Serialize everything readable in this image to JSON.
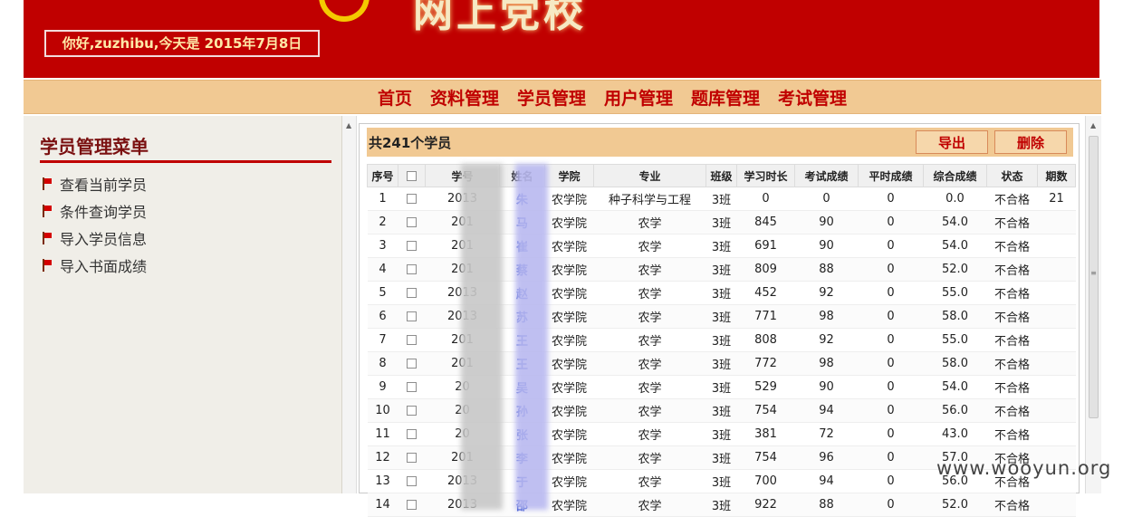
{
  "banner": {
    "logo_text": "网上党校",
    "greeting": "你好,zuzhibu,今天是 2015年7月8日"
  },
  "nav": {
    "items": [
      "首页",
      "资料管理",
      "学员管理",
      "用户管理",
      "题库管理",
      "考试管理"
    ]
  },
  "sidebar": {
    "title": "学员管理菜单",
    "items": [
      "查看当前学员",
      "条件查询学员",
      "导入学员信息",
      "导入书面成绩"
    ]
  },
  "list": {
    "count_label": "共241个学员",
    "export_label": "导出",
    "delete_label": "删除",
    "columns": [
      "序号",
      "",
      "学号",
      "姓名",
      "学院",
      "专业",
      "班级",
      "学习时长",
      "考试成绩",
      "平时成绩",
      "综合成绩",
      "状态",
      "期数"
    ],
    "rows": [
      [
        "1",
        "",
        "2013",
        "朱",
        "农学院",
        "种子科学与工程",
        "3班",
        "0",
        "0",
        "0",
        "0.0",
        "不合格",
        "21"
      ],
      [
        "2",
        "",
        "201",
        "马",
        "农学院",
        "农学",
        "3班",
        "845",
        "90",
        "0",
        "54.0",
        "不合格",
        ""
      ],
      [
        "3",
        "",
        "201",
        "崔",
        "农学院",
        "农学",
        "3班",
        "691",
        "90",
        "0",
        "54.0",
        "不合格",
        ""
      ],
      [
        "4",
        "",
        "201",
        "蔡",
        "农学院",
        "农学",
        "3班",
        "809",
        "88",
        "0",
        "52.0",
        "不合格",
        ""
      ],
      [
        "5",
        "",
        "2013",
        "赵",
        "农学院",
        "农学",
        "3班",
        "452",
        "92",
        "0",
        "55.0",
        "不合格",
        ""
      ],
      [
        "6",
        "",
        "2013",
        "苏",
        "农学院",
        "农学",
        "3班",
        "771",
        "98",
        "0",
        "58.0",
        "不合格",
        ""
      ],
      [
        "7",
        "",
        "201",
        "王",
        "农学院",
        "农学",
        "3班",
        "808",
        "92",
        "0",
        "55.0",
        "不合格",
        ""
      ],
      [
        "8",
        "",
        "201",
        "王",
        "农学院",
        "农学",
        "3班",
        "772",
        "98",
        "0",
        "58.0",
        "不合格",
        ""
      ],
      [
        "9",
        "",
        "20",
        "吴",
        "农学院",
        "农学",
        "3班",
        "529",
        "90",
        "0",
        "54.0",
        "不合格",
        ""
      ],
      [
        "10",
        "",
        "20",
        "孙",
        "农学院",
        "农学",
        "3班",
        "754",
        "94",
        "0",
        "56.0",
        "不合格",
        ""
      ],
      [
        "11",
        "",
        "20",
        "张",
        "农学院",
        "农学",
        "3班",
        "381",
        "72",
        "0",
        "43.0",
        "不合格",
        ""
      ],
      [
        "12",
        "",
        "201",
        "李",
        "农学院",
        "农学",
        "3班",
        "754",
        "96",
        "0",
        "57.0",
        "不合格",
        ""
      ],
      [
        "13",
        "",
        "2013",
        "于",
        "农学院",
        "农学",
        "3班",
        "700",
        "94",
        "0",
        "56.0",
        "不合格",
        ""
      ],
      [
        "14",
        "",
        "2013",
        "邵",
        "农学院",
        "农学",
        "3班",
        "922",
        "88",
        "0",
        "52.0",
        "不合格",
        ""
      ]
    ]
  },
  "watermark": "www.wooyun.org"
}
